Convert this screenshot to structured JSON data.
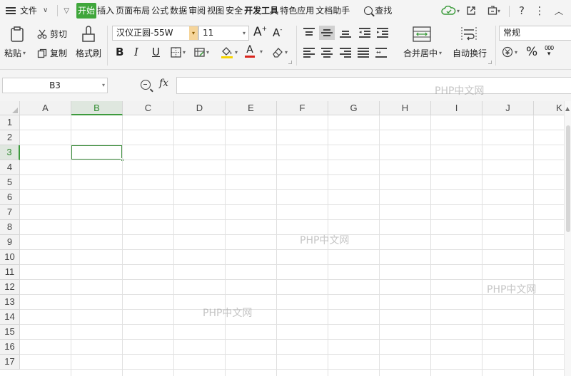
{
  "menubar": {
    "file_label": "文件",
    "tabs": [
      "开始",
      "插入",
      "页面布局",
      "公式",
      "数据",
      "审阅",
      "视图",
      "安全",
      "开发工具",
      "特色应用",
      "文档助手"
    ],
    "active_tab": "开始",
    "search_label": "查找",
    "help_glyph": "?",
    "more_glyph": "⋮",
    "collapse_glyph": "︿"
  },
  "ribbon": {
    "paste_label": "粘贴",
    "cut_label": "剪切",
    "copy_label": "复制",
    "format_painter_label": "格式刷",
    "font_name": "汉仪正圆-55W",
    "font_size": "11",
    "bold_glyph": "B",
    "italic_glyph": "I",
    "underline_glyph": "U",
    "grow_font_glyph": "A",
    "shrink_font_glyph": "A",
    "font_color_glyph": "A",
    "merge_center_label": "合并居中",
    "wrap_text_label": "自动换行",
    "number_format": "常规",
    "percent_glyph": "%",
    "thousands_glyph": "000"
  },
  "formula_bar": {
    "name_box": "B3",
    "fx_label": "fx",
    "formula": ""
  },
  "grid": {
    "columns": [
      "A",
      "B",
      "C",
      "D",
      "E",
      "F",
      "G",
      "H",
      "I",
      "J",
      "K"
    ],
    "rows": [
      "1",
      "2",
      "3",
      "4",
      "5",
      "6",
      "7",
      "8",
      "9",
      "10",
      "11",
      "12",
      "13",
      "14",
      "15",
      "16",
      "17"
    ],
    "selected_cell": "B3",
    "selected_column": "B",
    "selected_row": "3"
  },
  "watermarks": [
    "PHP中文网",
    "PHP中文网",
    "PHP中文网",
    "PHP中文网"
  ],
  "colors": {
    "accent_green": "#3fa63b",
    "selection_green": "#3d8f3d",
    "font_color_bar": "#d9241c",
    "fill_color_bar": "#f5d300"
  }
}
